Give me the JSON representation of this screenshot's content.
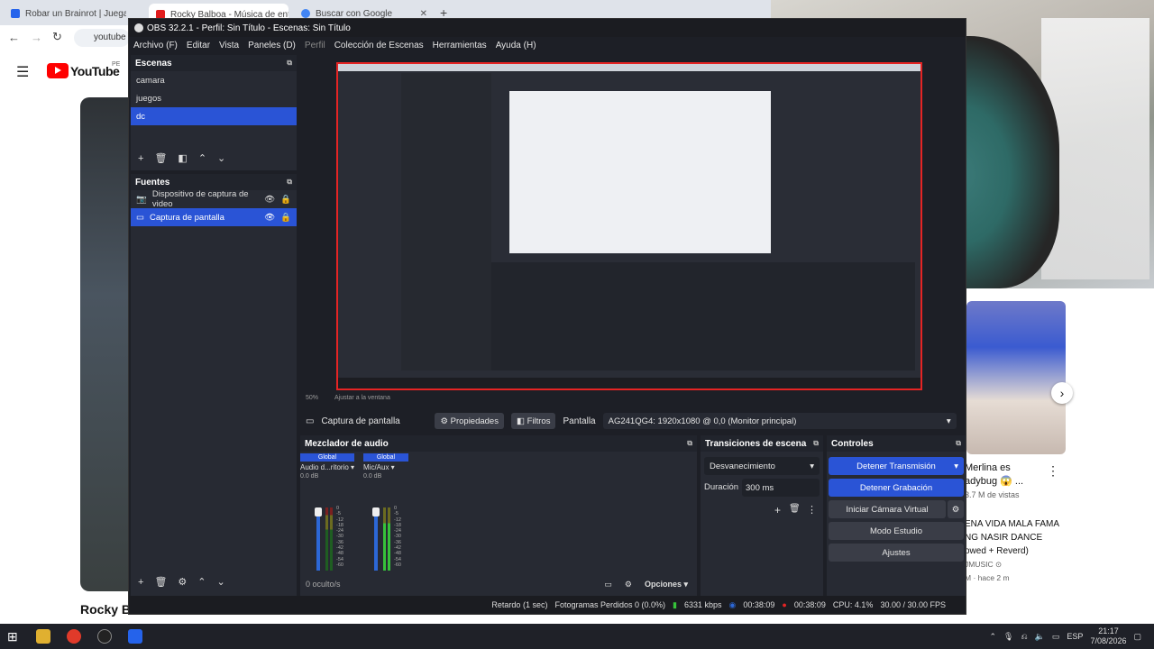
{
  "browser": {
    "tabs": [
      {
        "title": "Robar un Brainrot | Juega en R",
        "favicon_color": "#2563eb"
      },
      {
        "title": "Rocky Balboa - Música de entr",
        "favicon_color": "#e11d1d"
      },
      {
        "title": "Buscar con Google",
        "favicon_color": "#4285f4"
      }
    ],
    "new_tab": "+",
    "url_fragment": "youtube",
    "page_partial_title": "Rocky B",
    "youtube_logo_text": "YouTube",
    "youtube_region": "PE"
  },
  "youtube_side": {
    "video_title_1": "Merlina es",
    "video_title_2": "adybug 😱 ...",
    "views": "3.7 M de vistas",
    "video2_line1": "ENA VIDA MALA FAMA",
    "video2_line2": "NG NASIR DANCE",
    "video2_line3": "owed + Reverd)",
    "channel": "JMUSIC ⊙",
    "age": "M · hace 2 m"
  },
  "obs": {
    "title": "OBS 32.2.1 - Perfil: Sin Título - Escenas: Sin Título",
    "menu": [
      "Archivo (F)",
      "Editar",
      "Vista",
      "Paneles (D)",
      "Perfil",
      "Colección de Escenas",
      "Herramientas",
      "Ayuda (H)"
    ],
    "scenes_title": "Escenas",
    "scenes": [
      "camara",
      "juegos",
      "dc"
    ],
    "sources_title": "Fuentes",
    "sources": [
      "Dispositivo de captura de video",
      "Captura de pantalla"
    ],
    "source_bar": {
      "name": "Captura de pantalla",
      "properties": "Propiedades",
      "filters": "Filtros",
      "screen_label": "Pantalla",
      "screen_value": "AG241QG4: 1920x1080 @ 0,0 (Monitor principal)"
    },
    "audio_title": "Mezclador de audio",
    "audio_channels": [
      {
        "global": "Global",
        "name": "Audio d...ritorio",
        "db": "0.0 dB"
      },
      {
        "global": "Global",
        "name": "Mic/Aux",
        "db": "0.0 dB"
      }
    ],
    "meter_scale": [
      "0",
      "-5",
      "-12",
      "-18",
      "-24",
      "-30",
      "-36",
      "-42",
      "-48",
      "-54",
      "-60"
    ],
    "hidden_count": "0 oculto/s",
    "options": "Opciones",
    "transitions_title": "Transiciones de escena",
    "transition_value": "Desvanecimiento",
    "duration_label": "Duración",
    "duration_value": "300 ms",
    "controls_title": "Controles",
    "controls": {
      "stop_stream": "Detener Transmisión",
      "stop_record": "Detener Grabación",
      "virtual_cam": "Iniciar Cámara Virtual",
      "studio_mode": "Modo Estudio",
      "settings": "Ajustes"
    },
    "preview_footer": {
      "zoom": "50%",
      "fit": "Ajustar a la ventana"
    },
    "status": {
      "delay": "Retardo (1 sec)",
      "dropped": "Fotogramas Perdidos 0 (0.0%)",
      "bitrate": "6331 kbps",
      "stream_time": "00:38:09",
      "record_time": "00:38:09",
      "cpu": "CPU: 4.1%",
      "fps": "30.00 / 30.00 FPS"
    }
  },
  "taskbar": {
    "lang": "ESP",
    "time": "21:17",
    "date": "7/08/2026"
  },
  "colors": {
    "accent": "#2a54d6",
    "record_red": "#e52424",
    "meter_green": "#36c23a"
  }
}
